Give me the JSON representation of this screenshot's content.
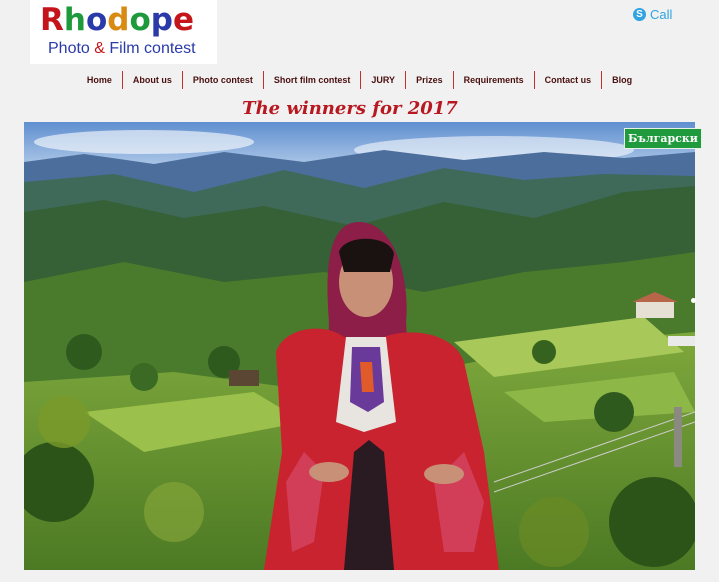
{
  "logo": {
    "letters": [
      {
        "ch": "R",
        "color": "#c4151a"
      },
      {
        "ch": "h",
        "color": "#1e9a3c"
      },
      {
        "ch": "o",
        "color": "#2a3aa8"
      },
      {
        "ch": "d",
        "color": "#d88a12"
      },
      {
        "ch": "o",
        "color": "#1e9a3c"
      },
      {
        "ch": "p",
        "color": "#2a3aa8"
      },
      {
        "ch": "e",
        "color": "#c4151a"
      }
    ],
    "subtitle_left": "Photo ",
    "subtitle_amp": "&",
    "subtitle_right": " Film contest"
  },
  "header": {
    "call_label": "Call",
    "call_icon": "skype-icon"
  },
  "nav": {
    "items": [
      "Home",
      "About us",
      "Photo contest",
      "Short film contest",
      "JURY",
      "Prizes",
      "Requirements",
      "Contact us",
      "Blog"
    ]
  },
  "main": {
    "headline": "The winners for 2017",
    "language_button": "Български"
  },
  "colors": {
    "accent_red": "#b81820",
    "nav_text": "#4a1010",
    "lang_green": "#1f9a3c",
    "call_blue": "#2fa4e1"
  }
}
